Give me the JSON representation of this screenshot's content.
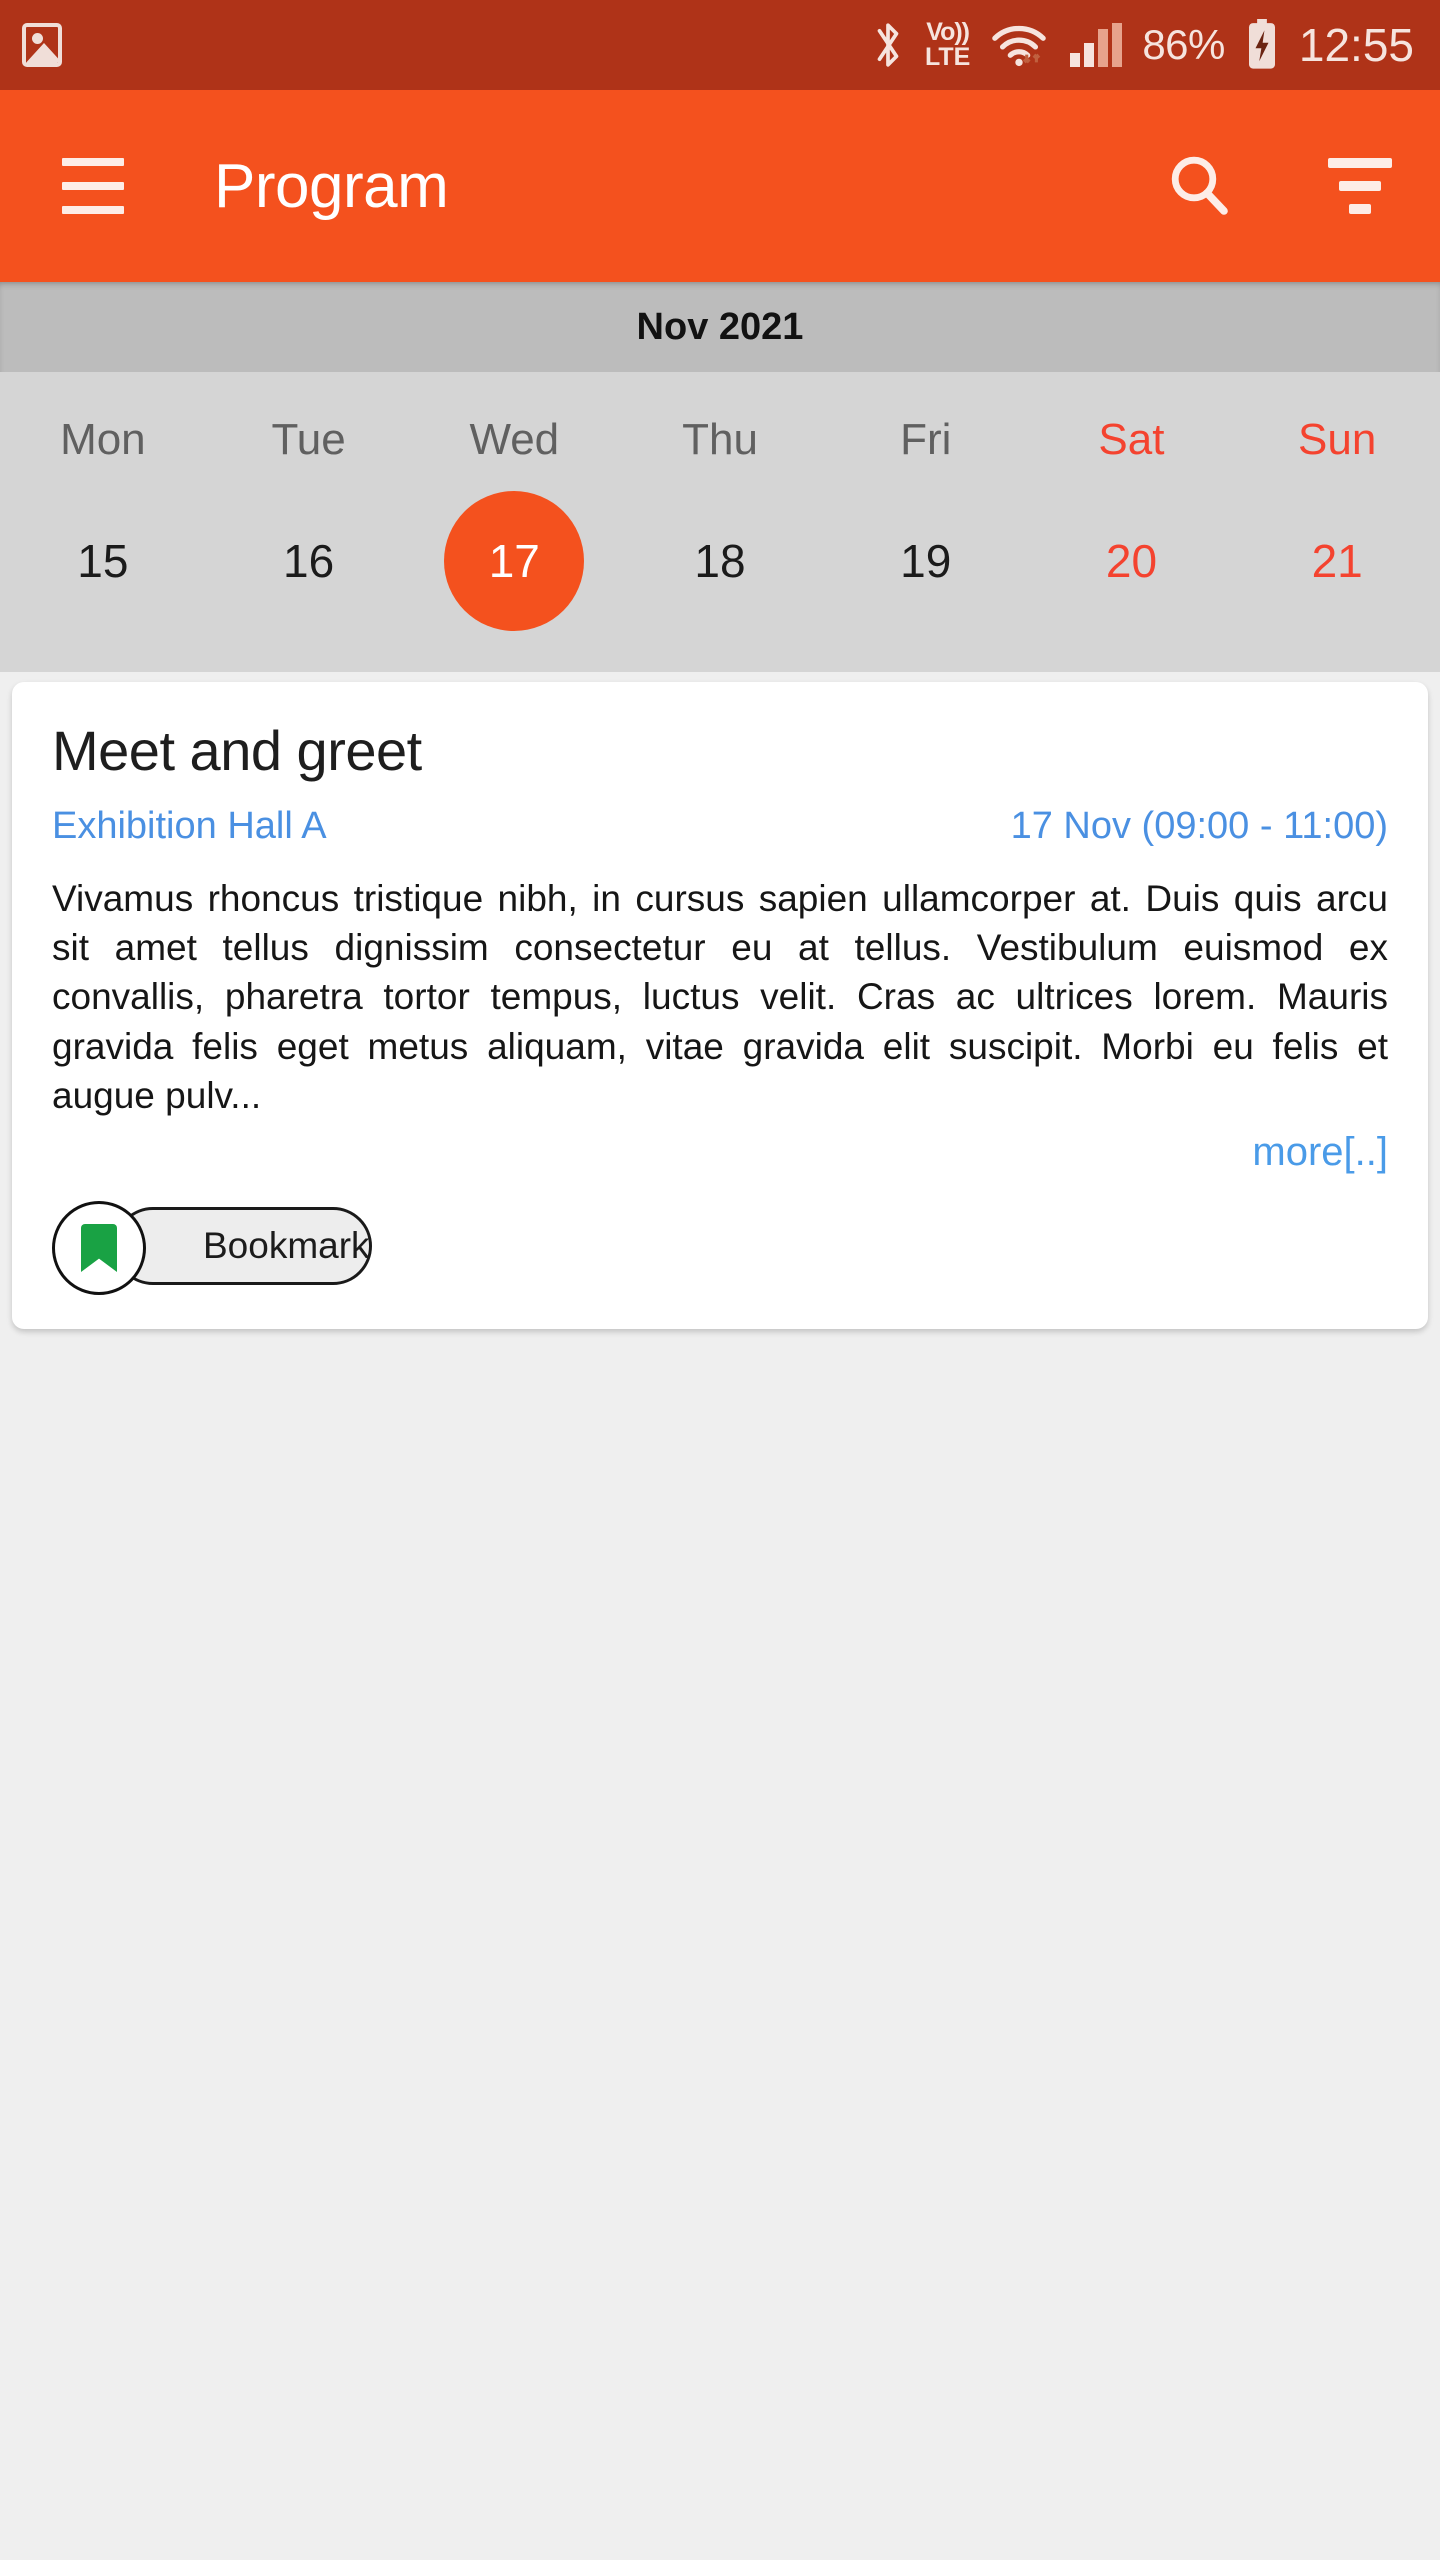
{
  "status_bar": {
    "left_icons": [
      {
        "name": "photo-icon",
        "label": "image"
      }
    ],
    "right_icons": [
      {
        "name": "bluetooth-icon",
        "label": "Bluetooth"
      },
      {
        "name": "volte-icon",
        "label_top": "Vo))",
        "label_bottom": "LTE"
      },
      {
        "name": "wifi-icon",
        "label": "WiFi"
      },
      {
        "name": "cellular-signal-icon",
        "label": "Signal"
      },
      {
        "name": "battery-charging-icon",
        "label": "Charging"
      }
    ],
    "battery_percent": "86%",
    "clock": "12:55",
    "background": "#AF3318",
    "foreground": "#F6E4DE"
  },
  "app_bar": {
    "title": "Program",
    "menu_icon": "hamburger-menu-icon",
    "search_icon": "search-icon",
    "filter_icon": "filter-icon",
    "background": "#F4511E",
    "foreground": "#FFFFFF"
  },
  "calendar": {
    "month_label": "Nov 2021",
    "month_band_background": "#BCBCBC",
    "strip_background": "#D5D5D5",
    "selected_color": "#F4511E",
    "weekend_color": "#F4432F",
    "days": [
      {
        "dow": "Mon",
        "date": "15",
        "weekend": false,
        "selected": false
      },
      {
        "dow": "Tue",
        "date": "16",
        "weekend": false,
        "selected": false
      },
      {
        "dow": "Wed",
        "date": "17",
        "weekend": false,
        "selected": true
      },
      {
        "dow": "Thu",
        "date": "18",
        "weekend": false,
        "selected": false
      },
      {
        "dow": "Fri",
        "date": "19",
        "weekend": false,
        "selected": false
      },
      {
        "dow": "Sat",
        "date": "20",
        "weekend": true,
        "selected": false
      },
      {
        "dow": "Sun",
        "date": "21",
        "weekend": true,
        "selected": false
      }
    ]
  },
  "event": {
    "title": "Meet and greet",
    "venue": "Exhibition Hall A",
    "datetime": "17 Nov (09:00 - 11:00)",
    "description": "Vivamus rhoncus tristique nibh, in cursus sapien ullamcorper at. Duis quis arcu sit amet tellus dignissim consectetur eu at tellus. Vestibulum euismod ex convallis, pharetra tortor tempus, luctus velit. Cras ac ultrices lorem. Mauris gravida felis eget metus aliquam, vitae gravida elit suscipit. Morbi eu felis et augue pulv...",
    "more_label": "more[..]",
    "bookmark_label": "Bookmark",
    "bookmark_icon": "bookmark-flag-icon",
    "link_color": "#4A90E2",
    "bookmark_icon_color": "#19A244"
  }
}
